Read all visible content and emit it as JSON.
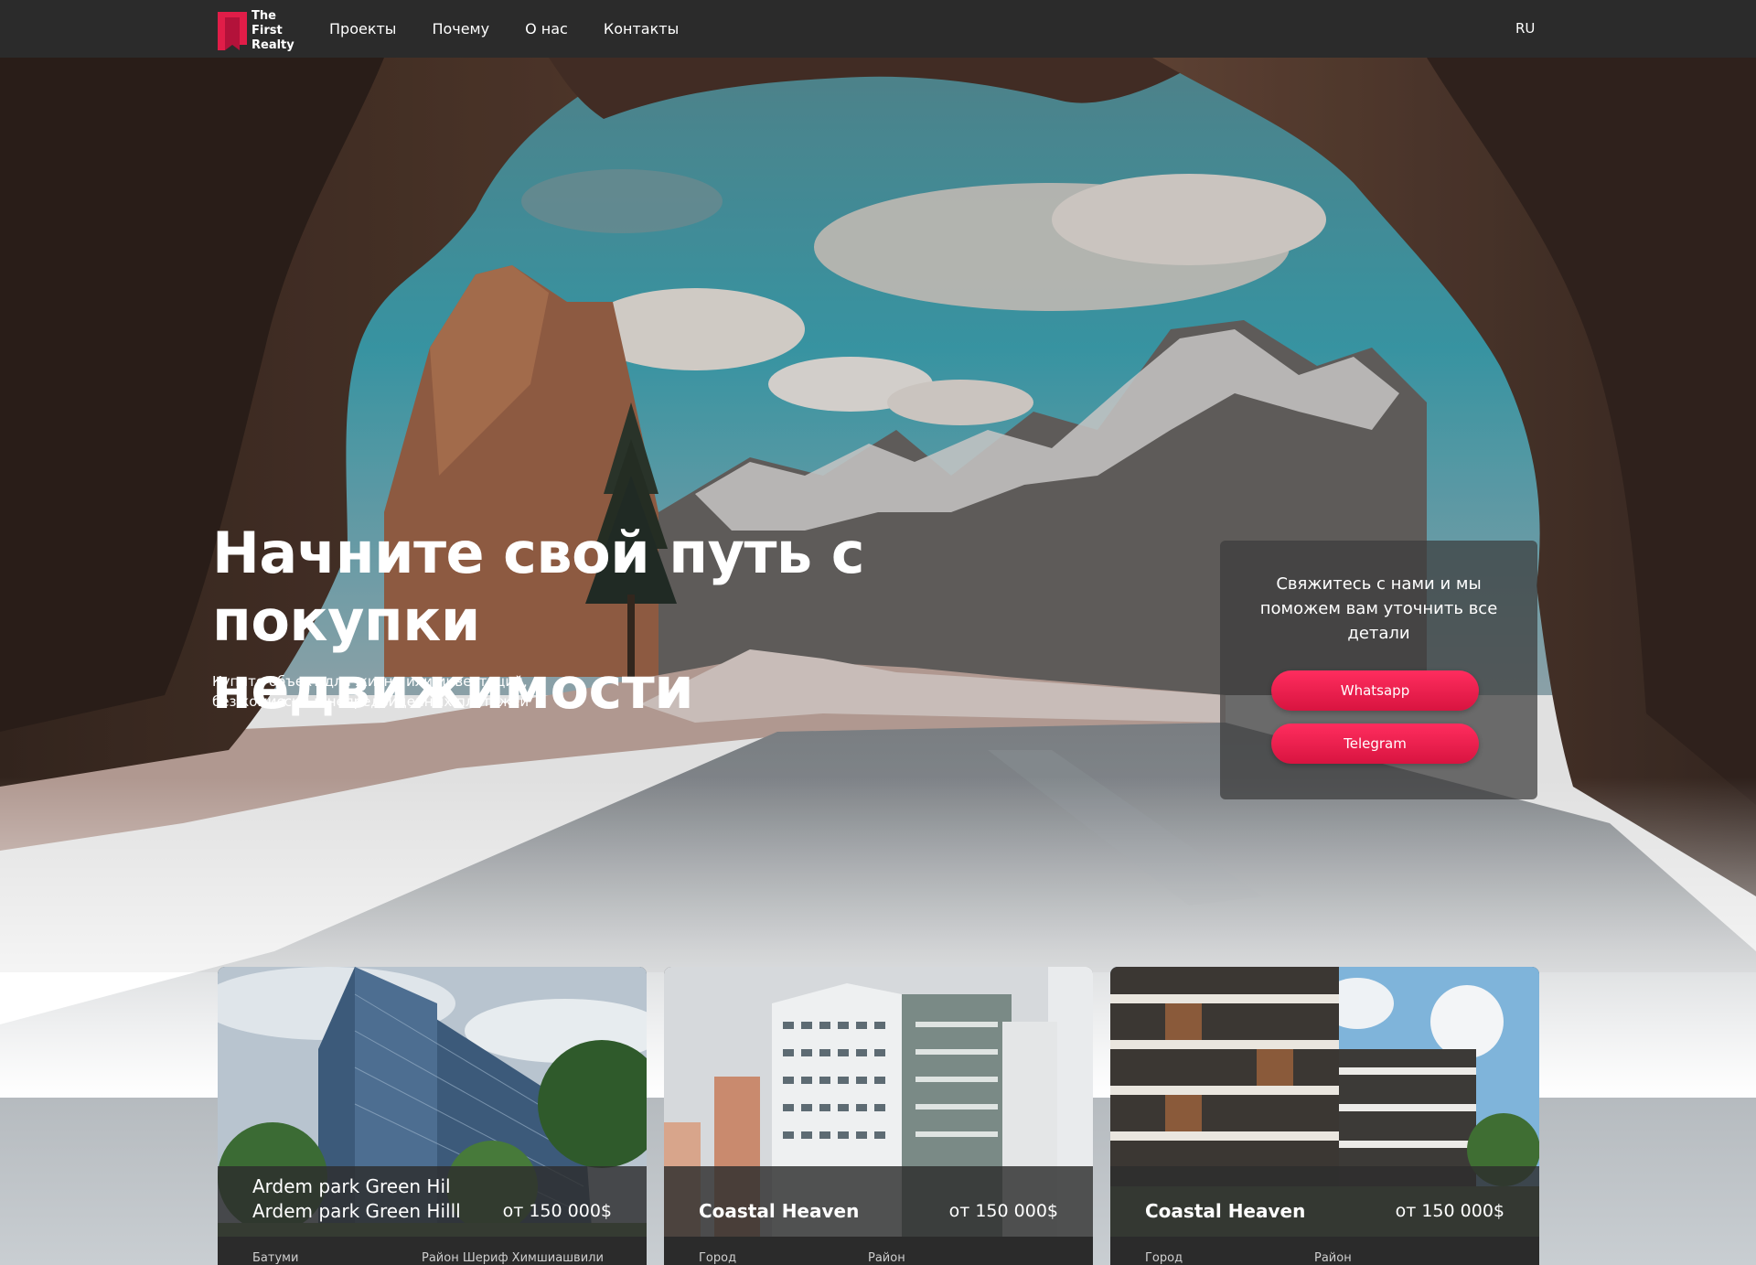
{
  "brand": {
    "name_line1": "The First",
    "name_line2": "Realty",
    "accent": "#e11d48"
  },
  "nav": {
    "items": [
      "Проекты",
      "Почему",
      "О нас",
      "Контакты"
    ],
    "lang": "RU"
  },
  "hero": {
    "title_line1": "Начните свой путь с",
    "title_line2": "покупки недвижимости",
    "subtitle_line1": "Купите объект для жизни или инвестиций,",
    "subtitle_line2": "без комиссий и непредвиденных платежей"
  },
  "contact": {
    "text": "Свяжитесь с нами и мы поможем вам уточнить все детали",
    "whatsapp_label": "Whatsapp",
    "telegram_label": "Telegram"
  },
  "projects": [
    {
      "title_line1": "Ardem park Green Hil",
      "title_line2": "Ardem park Green Hilll",
      "price": "от 150 000$",
      "meta_a": "Батуми",
      "meta_b": "Район Шериф Химшиашвили"
    },
    {
      "title_line1": "",
      "title_line2": "Coastal Heaven",
      "price": "от 150 000$",
      "meta_a": "Город",
      "meta_b": "Район"
    },
    {
      "title_line1": "",
      "title_line2": "Coastal Heaven",
      "price": "от 150 000$",
      "meta_a": "Город",
      "meta_b": "Район"
    }
  ]
}
